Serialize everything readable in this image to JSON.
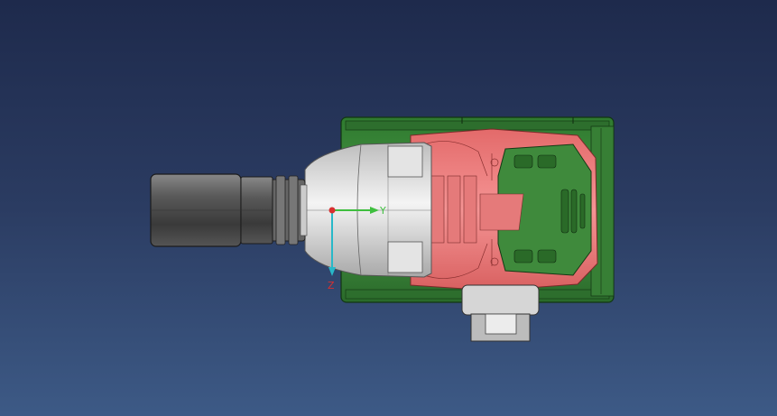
{
  "viewport": {
    "background_top": "#1e2a4c",
    "background_bottom": "#3d5a86"
  },
  "model": {
    "housing_color": "#3d8a3a",
    "housing_dark": "#1f4d1f",
    "motor_color": "#f08080",
    "motor_dark": "#b04848",
    "nose_color": "#eeeeee",
    "socket_color": "#555555",
    "bracket_color": "#cfcfcf"
  },
  "axes": {
    "y_label": "Y",
    "z_label": "Z",
    "y_color": "#3fbf3f",
    "z_color": "#28b8c8",
    "origin_color": "#d83030"
  }
}
